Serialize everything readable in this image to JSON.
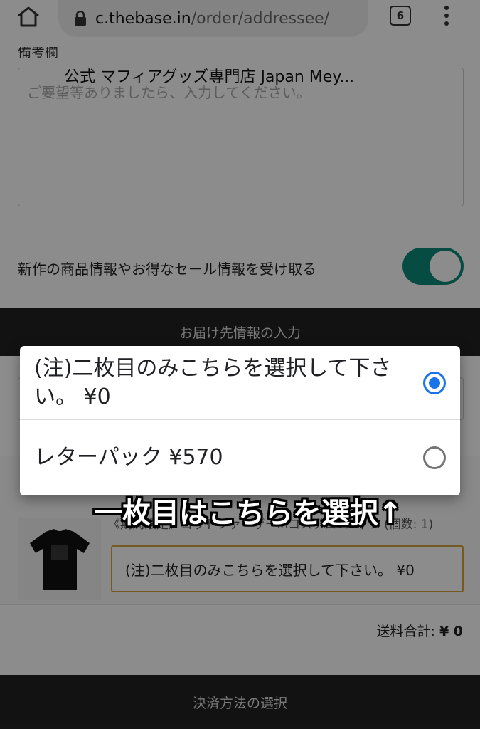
{
  "browser": {
    "url_host": "c.thebase.in",
    "url_path": "/order/addressee/",
    "tab_count": "6"
  },
  "store": {
    "title": "公式 マフィアグッズ専門店 Japan Mey..."
  },
  "form": {
    "remarks_label": "備考欄",
    "remarks_placeholder": "ご要望等ありましたら、入力してください。",
    "newsletter_label": "新作の商品情報やお得なセール情報を受け取る",
    "newsletter_on": true
  },
  "sections": {
    "delivery": "お届け先情報の入力",
    "payment": "決済方法の選択"
  },
  "product": {
    "name": "《期間限定》ゴッドファーザーinコスデロTシャツ (個数: 1)",
    "selected_shipping": "(注)二枚目のみこちらを選択して下さい。 ¥0"
  },
  "shipping_total": {
    "label": "送料合計:",
    "value": "¥ 0"
  },
  "dialog": {
    "options": [
      {
        "label": "(注)二枚目のみこちらを選択して下さい。 ¥0",
        "checked": true
      },
      {
        "label": "レターパック ¥570",
        "checked": false
      }
    ]
  },
  "annotation": "一枚目はこちらを選択↑",
  "colors": {
    "accent": "#1a73e8",
    "toggle": "#0e8a7a",
    "highlight_border": "#d6a63f"
  }
}
